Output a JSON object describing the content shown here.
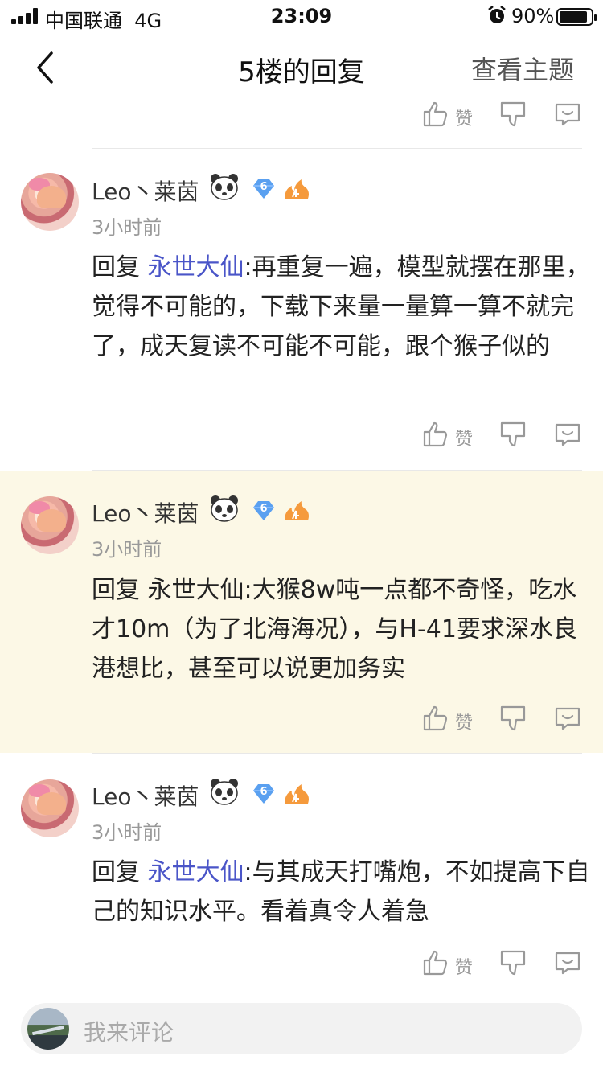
{
  "status_bar": {
    "carrier": "中国联通",
    "network": "4G",
    "time": "23:09",
    "battery": "90%",
    "battery_level": 0.9
  },
  "nav": {
    "title": "5楼的回复",
    "view_topic": "查看主题"
  },
  "action_labels": {
    "like": "赞"
  },
  "comments": [
    {
      "username": "Leo丶莱茵",
      "level": "6",
      "time": "3小时前",
      "reply_prefix": "回复",
      "mention": "永世大仙",
      "text": ":再重复一遍，模型就摆在那里，觉得不可能的，下载下来量一量算一算不就完了，成天复读不可能不可能，跟个猴子似的",
      "highlighted": false
    },
    {
      "username": "Leo丶莱茵",
      "level": "6",
      "time": "3小时前",
      "reply_prefix": "回复",
      "mention": "永世大仙",
      "text": ":大猴8w吨一点都不奇怪，吃水才10m（为了北海海况），与H-41要求深水良港想比，甚至可以说更加务实",
      "highlighted": true
    },
    {
      "username": "Leo丶莱茵",
      "level": "6",
      "time": "3小时前",
      "reply_prefix": "回复",
      "mention": "永世大仙",
      "text": ":与其成天打嘴炮，不如提高下自己的知识水平。看着真令人着急",
      "highlighted": false
    }
  ],
  "composer": {
    "placeholder": "我来评论"
  },
  "colors": {
    "mention": "#4a55c8",
    "highlight_bg": "#fcf8e6",
    "level_badge": "#5aa0f0",
    "flame_badge": "#f59a3c"
  },
  "icons": [
    "like-icon",
    "dislike-icon",
    "reply-icon",
    "back-chevron-icon",
    "panda-emoji-icon",
    "level-badge-icon",
    "flame-badge-icon",
    "alarm-icon"
  ]
}
